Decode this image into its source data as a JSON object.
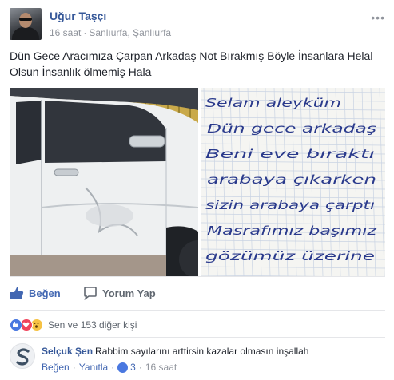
{
  "post": {
    "author": "Uğur Taşçı",
    "time": "16 saat",
    "separator": "·",
    "location": "Sanlıurfa, Şanlıurfa",
    "more_icon": "ellipsis-icon",
    "text": "Dün Gece Aracımıza Çarpan Arkadaş Not Bırakmış Böyle İnsanlara Helal Olsun İnsanlık ölmemiş Hala"
  },
  "note": {
    "lines": [
      "Selam aleyküm",
      "Dün gece arkadaş",
      "Beni eve bıraktı",
      "arabaya çıkarken",
      "sizin arabaya çarptı",
      "Masrafımız başımız",
      "gözümüz üzerine"
    ],
    "ink_color": "#2a3a8c"
  },
  "actions": {
    "like_label": "Beğen",
    "comment_label": "Yorum Yap",
    "like_color": "#4267b2"
  },
  "reactions": {
    "summary": "Sen ve 153 diğer kişi",
    "icons": [
      "like-reaction-icon",
      "love-reaction-icon",
      "wow-reaction-icon"
    ]
  },
  "comment": {
    "author": "Selçuk Şen",
    "text": "Rabbim sayılarını arttirsin kazalar olmasın inşallah",
    "like_label": "Beğen",
    "reply_label": "Yanıtla",
    "separator": "·",
    "like_count": "3",
    "time": "16 saat"
  }
}
